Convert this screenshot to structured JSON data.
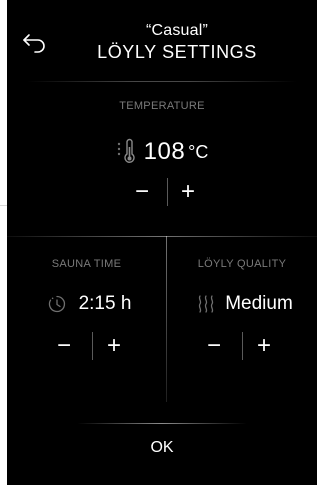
{
  "header": {
    "preset_name": "“Casual”",
    "title": "LÖYLY SETTINGS",
    "back_icon": "back-arrow-icon"
  },
  "temperature": {
    "label": "TEMPERATURE",
    "icon": "thermometer-icon",
    "value": "108",
    "unit": "°C",
    "decrease_label": "−",
    "increase_label": "+"
  },
  "sauna_time": {
    "label": "SAUNA TIME",
    "icon": "clock-icon",
    "value": "2:15 h",
    "decrease_label": "−",
    "increase_label": "+"
  },
  "loyly_quality": {
    "label": "LÖYLY QUALITY",
    "icon": "steam-icon",
    "value": "Medium",
    "decrease_label": "−",
    "increase_label": "+"
  },
  "ok_label": "OK",
  "colors": {
    "background": "#000000",
    "text": "#ffffff",
    "label": "#7a7a7a",
    "icon_dim": "#6f6f6f"
  }
}
